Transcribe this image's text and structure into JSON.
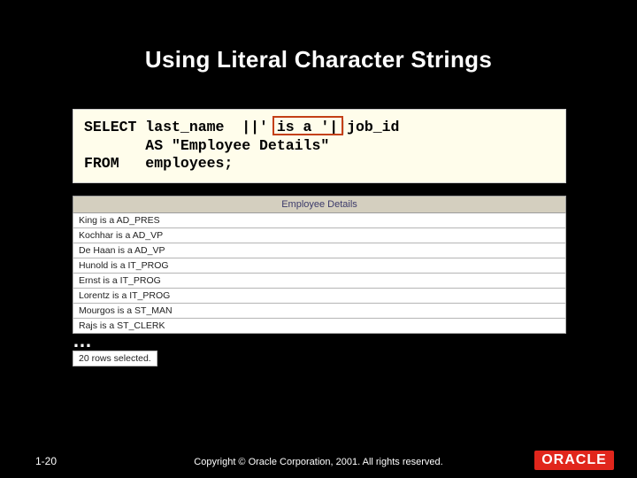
{
  "title": "Using Literal Character Strings",
  "sql": {
    "line1": "SELECT last_name  ||' is a '||job_id",
    "line2": "       AS \"Employee Details\"",
    "line3": "FROM   employees;"
  },
  "result": {
    "header": "Employee Details",
    "rows": [
      "King is a AD_PRES",
      "Kochhar is a AD_VP",
      "De Haan is a AD_VP",
      "Hunold is a IT_PROG",
      "Ernst is a IT_PROG",
      "Lorentz is a IT_PROG",
      "Mourgos is a ST_MAN",
      "Rajs is a ST_CLERK"
    ],
    "status": "20 rows selected."
  },
  "ellipsis": "…",
  "footer": {
    "page": "1-20",
    "copyright": "Copyright © Oracle Corporation, 2001. All rights reserved.",
    "logo_text": "ORACLE"
  }
}
